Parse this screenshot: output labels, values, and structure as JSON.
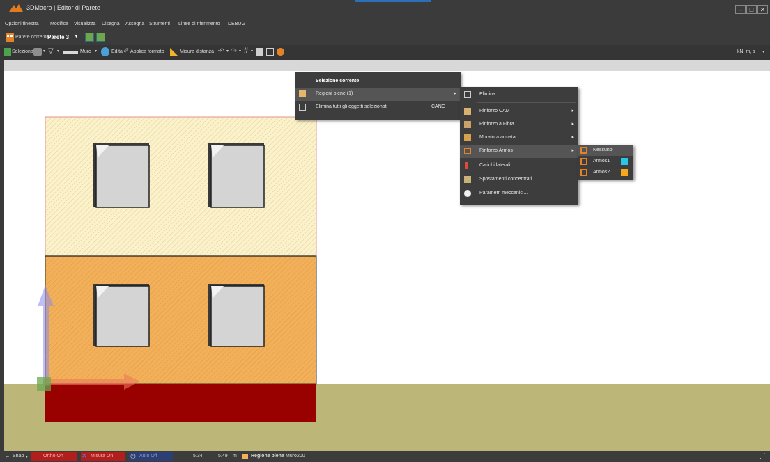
{
  "window": {
    "title": "3DMacro | Editor di Parete",
    "buttons": {
      "minimize": "–",
      "maximize": "□",
      "close": "✕"
    }
  },
  "menubar": [
    "Opzioni finestra",
    "Modifica",
    "Visualizza",
    "Disegna",
    "Assegna",
    "Strumenti",
    "Linee di riferimento",
    "DEBUG"
  ],
  "wall_selector": {
    "label": "Parete corrente",
    "value": "Parete 3"
  },
  "toolbar": {
    "seleziona": "Seleziona",
    "muro": "Muro",
    "edita": "Edita",
    "applica_formato": "Applica formato",
    "misura_distanza": "Misura distanza",
    "units": "kN, m, s"
  },
  "context_menu": {
    "header": "Selezione corrente",
    "items": [
      {
        "label": "Regioni piene (1)"
      },
      {
        "label": "Elimina tutti gli oggetti selezionati",
        "shortcut": "CANC"
      }
    ]
  },
  "submenu": {
    "items": [
      {
        "label": "Elimina"
      },
      {
        "label": "Rinforzo CAM"
      },
      {
        "label": "Rinforzo a Fibra"
      },
      {
        "label": "Muratura armata"
      },
      {
        "label": "Rinforzo Armos"
      },
      {
        "label": "Carichi laterali..."
      },
      {
        "label": "Spostamenti concentrati..."
      },
      {
        "label": "Parametri meccanici..."
      }
    ]
  },
  "armos_menu": {
    "items": [
      {
        "label": "Nessuno"
      },
      {
        "label": "Armos1",
        "swatch": "#29c6e8"
      },
      {
        "label": "Armos2",
        "swatch": "#f5a81c"
      }
    ]
  },
  "statusbar": {
    "snap": "Snap",
    "ortho": "Ortho On",
    "misura": "Misura On",
    "auto": "Auto Off",
    "x": "5.34",
    "y": "5.49",
    "unit": "m",
    "region_label": "Regione piena",
    "region_name": "Muro200"
  },
  "colors": {
    "upper_fill": "#fbf2cc",
    "lower_fill": "#f2b05a",
    "foundation": "#990000",
    "ground": "#bcb778",
    "window_fill": "#d4d4d4"
  }
}
